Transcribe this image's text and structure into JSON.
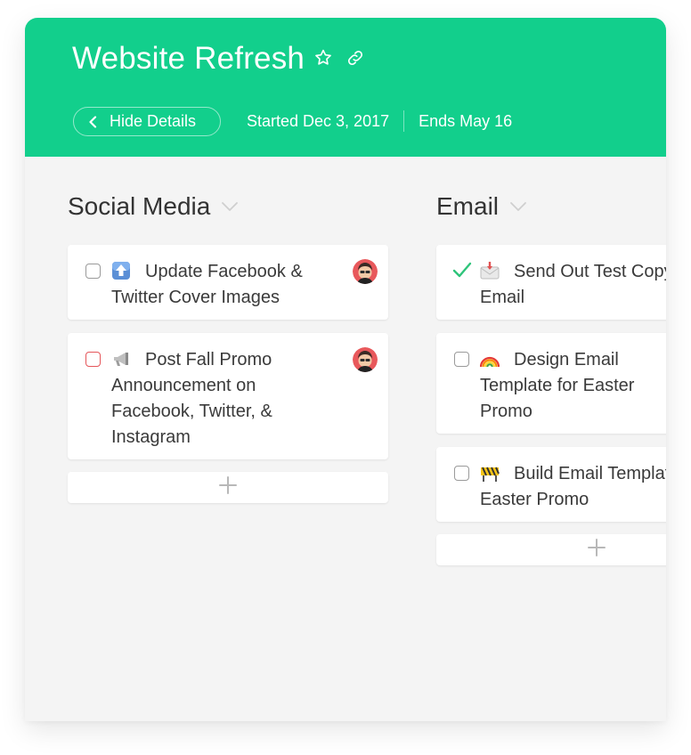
{
  "project": {
    "title": "Website Refresh",
    "hide_details_label": "Hide Details",
    "started": "Started Dec 3, 2017",
    "ends": "Ends May 16"
  },
  "columns": [
    {
      "title": "Social Media",
      "cards": [
        {
          "text": "Update Facebook & Twitter Cover Images",
          "status": "unchecked",
          "icon": "up-arrow-emoji",
          "assignee": "avatar"
        },
        {
          "text": "Post Fall Promo Announcement on Facebook, Twitter, & Instagram",
          "status": "unchecked-red",
          "icon": "megaphone-emoji",
          "assignee": "avatar"
        }
      ],
      "add_label": "+"
    },
    {
      "title": "Email",
      "cards": [
        {
          "text": "Send Out Test Copy of Email",
          "status": "done",
          "icon": "envelope-emoji"
        },
        {
          "text": "Design Email Template for Easter Promo",
          "status": "unchecked",
          "icon": "rainbow-emoji"
        },
        {
          "text": "Build Email Template for Easter Promo",
          "status": "unchecked",
          "icon": "construction-emoji"
        }
      ],
      "add_label": "+"
    }
  ],
  "colors": {
    "header": "#12cf8c",
    "board": "#f4f4f4",
    "done_check": "#2ec47a",
    "red_checkbox": "#e5565a"
  }
}
